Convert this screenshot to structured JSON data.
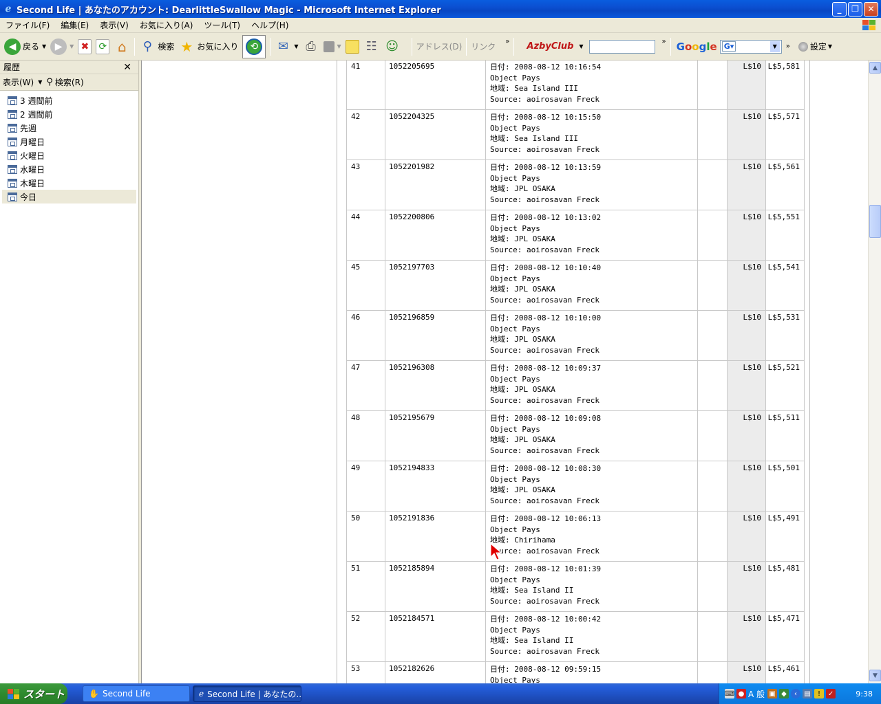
{
  "window": {
    "title": "Second Life | あなたのアカウント: DearlittleSwallow Magic - Microsoft Internet Explorer"
  },
  "menu": [
    "ファイル(F)",
    "編集(E)",
    "表示(V)",
    "お気に入り(A)",
    "ツール(T)",
    "ヘルプ(H)"
  ],
  "toolbar": {
    "back_label": "戻る",
    "search_label": "検索",
    "favorites_label": "お気に入り",
    "address_label": "アドレス(D)",
    "links_label": "リンク",
    "azby_label": "AzbyClub",
    "google_label": "Google",
    "settings_label": "設定"
  },
  "history": {
    "title": "履歴",
    "view_label": "表示(W)",
    "search_label": "検索(R)",
    "items": [
      "3 週間前",
      "2 週間前",
      "先週",
      "月曜日",
      "火曜日",
      "水曜日",
      "木曜日",
      "今日"
    ],
    "selected_index": 7
  },
  "transactions": [
    {
      "no": "41",
      "id": "1052205695",
      "date": "日付: 2008-08-12 10:16:54",
      "type": "Object Pays",
      "region": "地域: Sea Island III",
      "source": "Source: aoirosavan Freck",
      "amount": "L$10",
      "balance": "L$5,581"
    },
    {
      "no": "42",
      "id": "1052204325",
      "date": "日付: 2008-08-12 10:15:50",
      "type": "Object Pays",
      "region": "地域: Sea Island III",
      "source": "Source: aoirosavan Freck",
      "amount": "L$10",
      "balance": "L$5,571"
    },
    {
      "no": "43",
      "id": "1052201982",
      "date": "日付: 2008-08-12 10:13:59",
      "type": "Object Pays",
      "region": "地域: JPL OSAKA",
      "source": "Source: aoirosavan Freck",
      "amount": "L$10",
      "balance": "L$5,561"
    },
    {
      "no": "44",
      "id": "1052200806",
      "date": "日付: 2008-08-12 10:13:02",
      "type": "Object Pays",
      "region": "地域: JPL OSAKA",
      "source": "Source: aoirosavan Freck",
      "amount": "L$10",
      "balance": "L$5,551"
    },
    {
      "no": "45",
      "id": "1052197703",
      "date": "日付: 2008-08-12 10:10:40",
      "type": "Object Pays",
      "region": "地域: JPL OSAKA",
      "source": "Source: aoirosavan Freck",
      "amount": "L$10",
      "balance": "L$5,541"
    },
    {
      "no": "46",
      "id": "1052196859",
      "date": "日付: 2008-08-12 10:10:00",
      "type": "Object Pays",
      "region": "地域: JPL OSAKA",
      "source": "Source: aoirosavan Freck",
      "amount": "L$10",
      "balance": "L$5,531"
    },
    {
      "no": "47",
      "id": "1052196308",
      "date": "日付: 2008-08-12 10:09:37",
      "type": "Object Pays",
      "region": "地域: JPL OSAKA",
      "source": "Source: aoirosavan Freck",
      "amount": "L$10",
      "balance": "L$5,521"
    },
    {
      "no": "48",
      "id": "1052195679",
      "date": "日付: 2008-08-12 10:09:08",
      "type": "Object Pays",
      "region": "地域: JPL OSAKA",
      "source": "Source: aoirosavan Freck",
      "amount": "L$10",
      "balance": "L$5,511"
    },
    {
      "no": "49",
      "id": "1052194833",
      "date": "日付: 2008-08-12 10:08:30",
      "type": "Object Pays",
      "region": "地域: JPL OSAKA",
      "source": "Source: aoirosavan Freck",
      "amount": "L$10",
      "balance": "L$5,501"
    },
    {
      "no": "50",
      "id": "1052191836",
      "date": "日付: 2008-08-12 10:06:13",
      "type": "Object Pays",
      "region": "地域: Chirihama",
      "source": "Source: aoirosavan Freck",
      "amount": "L$10",
      "balance": "L$5,491"
    },
    {
      "no": "51",
      "id": "1052185894",
      "date": "日付: 2008-08-12 10:01:39",
      "type": "Object Pays",
      "region": "地域: Sea Island II",
      "source": "Source: aoirosavan Freck",
      "amount": "L$10",
      "balance": "L$5,481"
    },
    {
      "no": "52",
      "id": "1052184571",
      "date": "日付: 2008-08-12 10:00:42",
      "type": "Object Pays",
      "region": "地域: Sea Island II",
      "source": "Source: aoirosavan Freck",
      "amount": "L$10",
      "balance": "L$5,471"
    },
    {
      "no": "53",
      "id": "1052182626",
      "date": "日付: 2008-08-12 09:59:15",
      "type": "Object Pays",
      "region": "",
      "source": "",
      "amount": "L$10",
      "balance": "L$5,461"
    }
  ],
  "taskbar": {
    "start_label": "スタート",
    "tasks": [
      "Second Life",
      "Second Life | あなたの..."
    ],
    "ime_label": "A 般",
    "clock": "9:38"
  },
  "colors": {
    "titlebar": "#0a5ddf",
    "start_green": "#3c9a3c",
    "cursor_red": "#e00000",
    "amount_cell_bg": "#ececec"
  },
  "icons": {
    "back": "back-arrow-icon",
    "forward": "forward-arrow-icon",
    "stop": "stop-icon",
    "refresh": "refresh-icon",
    "home": "home-icon",
    "search": "magnifier-icon",
    "favorites": "star-icon",
    "history": "history-icon",
    "mail": "mail-icon",
    "print": "printer-icon"
  }
}
